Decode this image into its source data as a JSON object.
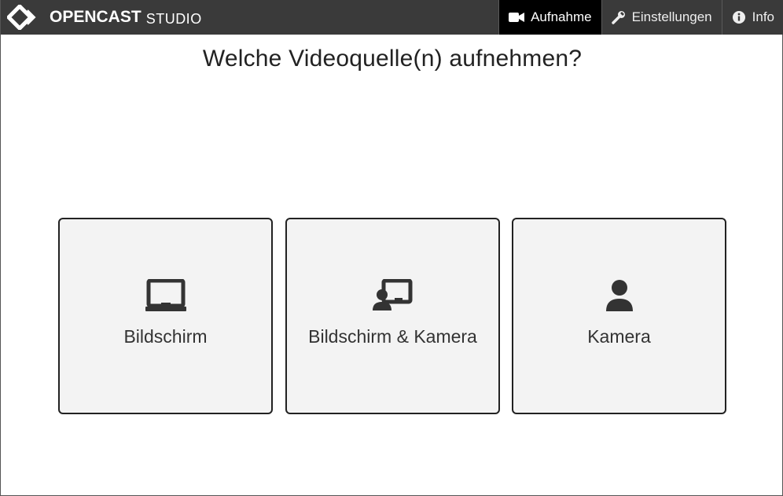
{
  "header": {
    "brand": {
      "name": "OPENCAST",
      "sub": "STUDIO"
    },
    "nav": [
      {
        "label": "Aufnahme",
        "icon": "video-camera-icon",
        "active": true
      },
      {
        "label": "Einstellungen",
        "icon": "wrench-icon",
        "active": false
      },
      {
        "label": "Info",
        "icon": "info-icon",
        "active": false
      }
    ]
  },
  "main": {
    "title": "Welche Videoquelle(n) aufnehmen?",
    "options": [
      {
        "label": "Bildschirm",
        "icon": "display-icon"
      },
      {
        "label": "Bildschirm & Kamera",
        "icon": "display-and-user-icon"
      },
      {
        "label": "Kamera",
        "icon": "user-icon"
      }
    ]
  },
  "colors": {
    "header_bg": "#3a3a3a",
    "active_tab_bg": "#000000",
    "card_bg": "#f3f3f3",
    "card_border": "#222222"
  }
}
